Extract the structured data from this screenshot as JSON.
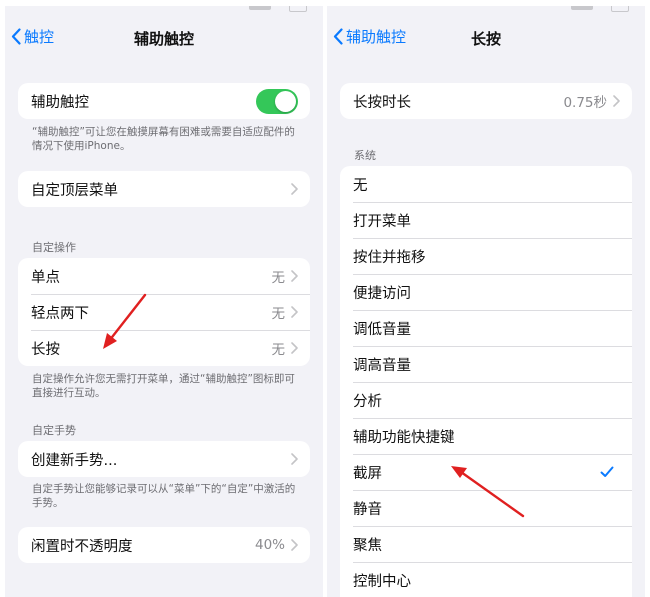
{
  "left_screen": {
    "back_label": "触控",
    "title": "辅助触控",
    "assistive_toggle": {
      "label": "辅助触控",
      "on": true
    },
    "assistive_footnote": "“辅助触控”可让您在触摸屏幕有困难或需要自适应配件的情况下使用iPhone。",
    "top_menu_label": "自定顶层菜单",
    "custom_actions_header": "自定操作",
    "custom_actions": [
      {
        "label": "单点",
        "value": "无"
      },
      {
        "label": "轻点两下",
        "value": "无"
      },
      {
        "label": "长按",
        "value": "无"
      }
    ],
    "custom_actions_footnote": "自定操作允许您无需打开菜单，通过“辅助触控”图标即可直接进行互动。",
    "custom_gestures_header": "自定手势",
    "create_gesture_label": "创建新手势...",
    "custom_gestures_footnote": "自定手势让您能够记录可以从“菜单”下的“自定”中激活的手势。",
    "idle_opacity": {
      "label": "闲置时不透明度",
      "value": "40%"
    }
  },
  "right_screen": {
    "back_label": "辅助触控",
    "title": "长按",
    "duration": {
      "label": "长按时长",
      "value": "0.75秒"
    },
    "system_header": "系统",
    "options": [
      {
        "label": "无",
        "selected": false
      },
      {
        "label": "打开菜单",
        "selected": false
      },
      {
        "label": "按住并拖移",
        "selected": false
      },
      {
        "label": "便捷访问",
        "selected": false
      },
      {
        "label": "调低音量",
        "selected": false
      },
      {
        "label": "调高音量",
        "selected": false
      },
      {
        "label": "分析",
        "selected": false
      },
      {
        "label": "辅助功能快捷键",
        "selected": false
      },
      {
        "label": "截屏",
        "selected": true
      },
      {
        "label": "静音",
        "selected": false
      },
      {
        "label": "聚焦",
        "selected": false
      },
      {
        "label": "控制中心",
        "selected": false
      }
    ]
  },
  "colors": {
    "accent": "#0a7aff",
    "toggle_on": "#34c759",
    "annotation_arrow": "#e02020",
    "background": "#f2f2f7"
  },
  "icons": {
    "back": "chevron-left-icon",
    "disclosure": "chevron-right-icon",
    "selected": "checkmark-icon"
  }
}
